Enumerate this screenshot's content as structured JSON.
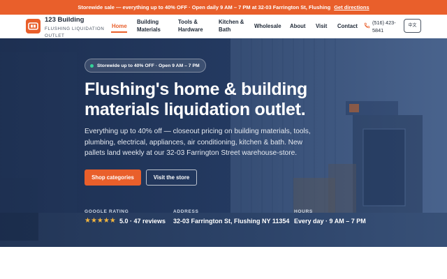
{
  "announcement": {
    "text": "Storewide sale — everything up to 40% OFF · Open daily 9 AM – 7 PM at 32-03 Farrington St, Flushing",
    "link_label": "Get directions"
  },
  "brand": {
    "name": "123 Building",
    "tagline": "FLUSHING LIQUIDATION OUTLET"
  },
  "nav": {
    "items": [
      {
        "label": "Home",
        "active": true
      },
      {
        "label": "Building Materials"
      },
      {
        "label": "Tools & Hardware"
      },
      {
        "label": "Kitchen & Bath"
      },
      {
        "label": "Wholesale"
      },
      {
        "label": "About"
      },
      {
        "label": "Visit"
      },
      {
        "label": "Contact"
      }
    ],
    "phone": "(516) 423-5841",
    "language_button": "中文"
  },
  "hero": {
    "badge": "Storewide up to 40% OFF · Open 9 AM – 7 PM",
    "title": "Flushing's home & building materials liquidation outlet.",
    "description": "Everything up to 40% off — closeout pricing on building materials, tools, plumbing, electrical, appliances, air conditioning, kitchen & bath. New pallets land weekly at our 32-03 Farrington Street warehouse-store.",
    "primary_button": "Shop categories",
    "secondary_button": "Visit the store",
    "stats": {
      "rating": {
        "label": "GOOGLE RATING",
        "stars": "★★★★★",
        "value": "5.0 · 47 reviews"
      },
      "address": {
        "label": "ADDRESS",
        "value": "32-03 Farrington St, Flushing NY 11354"
      },
      "hours": {
        "label": "HOURS",
        "value": "Every day · 9 AM – 7 PM"
      }
    }
  },
  "colors": {
    "accent": "#e95f2b",
    "hero_overlay": "#22385c",
    "star": "#f4b63f",
    "status_dot": "#34d399"
  },
  "icons": [
    "logo-mark-icon",
    "phone-icon",
    "status-dot-icon"
  ]
}
